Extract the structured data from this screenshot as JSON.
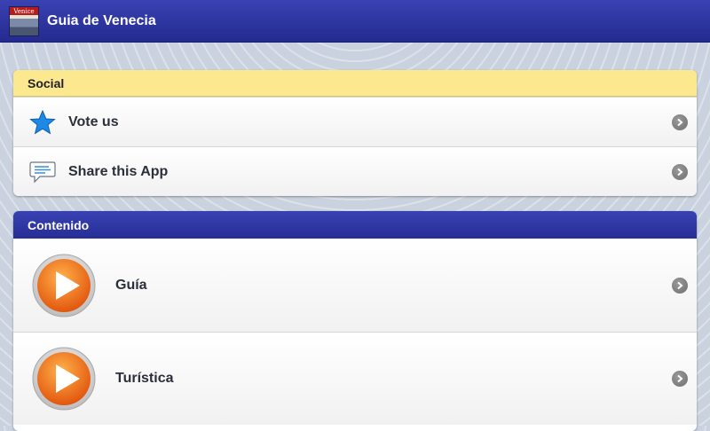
{
  "app": {
    "title": "Guia de Venecia",
    "icon": "venice-thumbnail-icon",
    "icon_text": "Venice"
  },
  "colors": {
    "titlebar": "#2b33a3",
    "social_header": "#fbe88f",
    "contenido_header": "#2f37a6",
    "play_orange": "#f07a1a",
    "star_blue": "#1e88e5"
  },
  "social": {
    "header": "Social",
    "items": [
      {
        "label": "Vote us",
        "icon": "star-icon"
      },
      {
        "label": "Share this App",
        "icon": "speech-bubble-icon"
      }
    ]
  },
  "contenido": {
    "header": "Contenido",
    "items": [
      {
        "label": "Guía",
        "icon": "play-icon"
      },
      {
        "label": "Turística",
        "icon": "play-icon"
      }
    ]
  }
}
